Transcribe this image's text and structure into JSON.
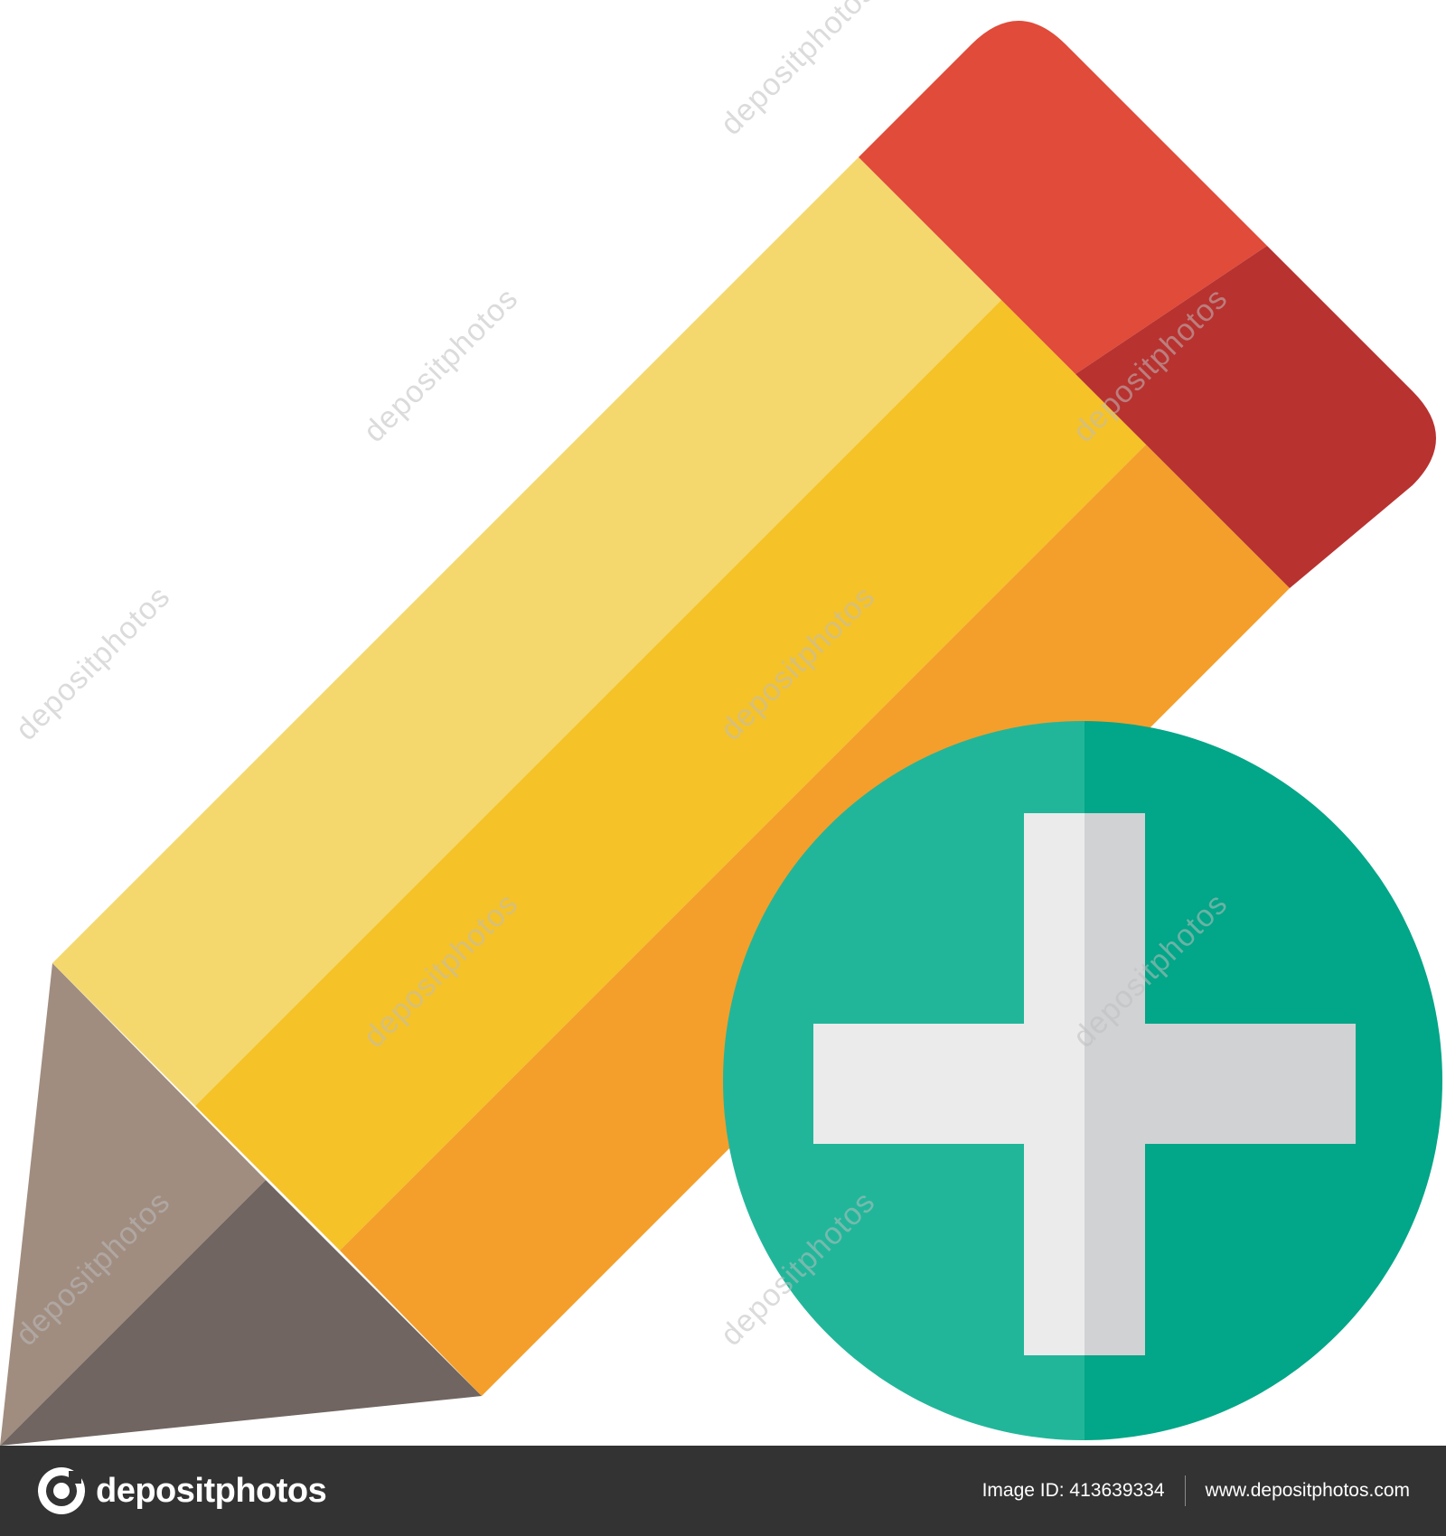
{
  "illustration": {
    "icon": "pencil-add-icon",
    "colors": {
      "eraser_light": "#E04B3A",
      "eraser_dark": "#B83230",
      "body_light": "#F4D86E",
      "body_mid": "#F5C227",
      "body_dark": "#F49F2B",
      "tip_light": "#A08D80",
      "tip_dark": "#706560",
      "badge_light": "#21B69A",
      "badge_dark": "#02A688",
      "plus_light": "#EBEBEC",
      "plus_dark": "#D1D2D4"
    }
  },
  "watermark": {
    "text": "depositphotos"
  },
  "footer": {
    "brand": "depositphotos",
    "image_id": "Image ID: 413639334",
    "website": "www.depositphotos.com"
  }
}
